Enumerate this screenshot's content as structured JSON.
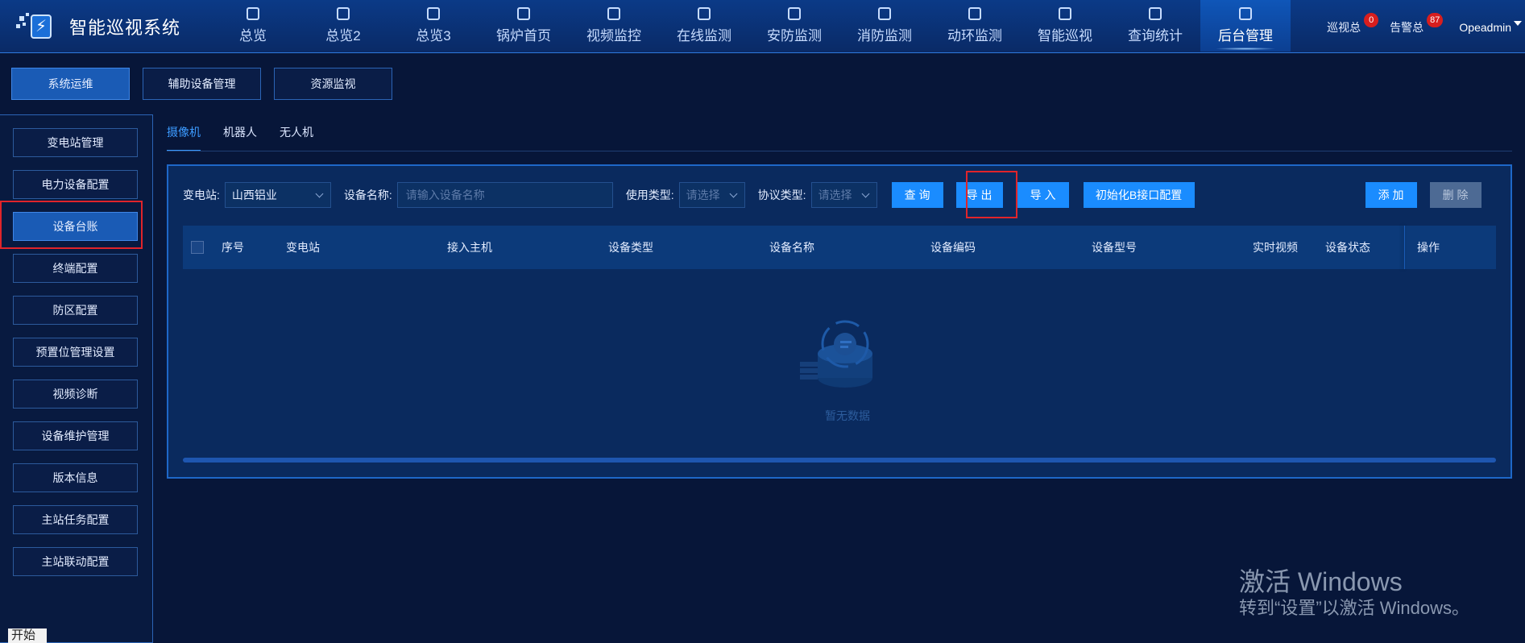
{
  "brand": {
    "title": "智能巡视系统",
    "logo_icon": "lightning-logo-icon"
  },
  "nav": {
    "items": [
      {
        "label": "总览",
        "icon": "home-icon"
      },
      {
        "label": "总览2",
        "icon": "shield-icon"
      },
      {
        "label": "总览3",
        "icon": "book-icon"
      },
      {
        "label": "锅炉首页",
        "icon": "boiler-icon"
      },
      {
        "label": "视频监控",
        "icon": "video-icon"
      },
      {
        "label": "在线监测",
        "icon": "monitor-icon"
      },
      {
        "label": "安防监测",
        "icon": "security-icon"
      },
      {
        "label": "消防监测",
        "icon": "fire-icon"
      },
      {
        "label": "动环监测",
        "icon": "environment-icon"
      },
      {
        "label": "智能巡视",
        "icon": "patrol-icon"
      },
      {
        "label": "查询统计",
        "icon": "query-icon"
      },
      {
        "label": "后台管理",
        "icon": "admin-icon"
      }
    ],
    "active": "后台管理"
  },
  "header_right": {
    "patrol_label": "巡视总",
    "patrol_count": "0",
    "alarm_label": "告警总",
    "alarm_count": "87",
    "user": "Opeadmin"
  },
  "subtabs": [
    "系统运维",
    "辅助设备管理",
    "资源监视"
  ],
  "sidemenu": {
    "items": [
      "变电站管理",
      "电力设备配置",
      "设备台账",
      "终端配置",
      "防区配置",
      "预置位管理设置",
      "视频诊断",
      "设备维护管理",
      "版本信息",
      "主站任务配置",
      "主站联动配置"
    ],
    "active": "设备台账"
  },
  "devtabs": [
    "摄像机",
    "机器人",
    "无人机"
  ],
  "filters": {
    "station_label": "变电站:",
    "station_value": "山西铝业",
    "name_label": "设备名称:",
    "name_placeholder": "请输入设备名称",
    "use_type_label": "使用类型:",
    "use_type_placeholder": "请选择",
    "protocol_label": "协议类型:",
    "protocol_placeholder": "请选择"
  },
  "buttons": {
    "query": "查 询",
    "export": "导 出",
    "import": "导 入",
    "init": "初始化B接口配置",
    "add": "添 加",
    "delete": "删 除"
  },
  "table": {
    "columns": [
      "序号",
      "变电站",
      "接入主机",
      "设备类型",
      "设备名称",
      "设备编码",
      "设备型号",
      "实时视频",
      "设备状态",
      "操作"
    ],
    "empty_text": "暂无数据"
  },
  "watermark": {
    "line1": "激活 Windows",
    "line2": "转到“设置”以激活 Windows。"
  },
  "start": "开始",
  "colors": {
    "background": "#071639",
    "accent": "#1a8cff",
    "highlight": "#e0242a",
    "active_tab": "#3c9bff"
  }
}
